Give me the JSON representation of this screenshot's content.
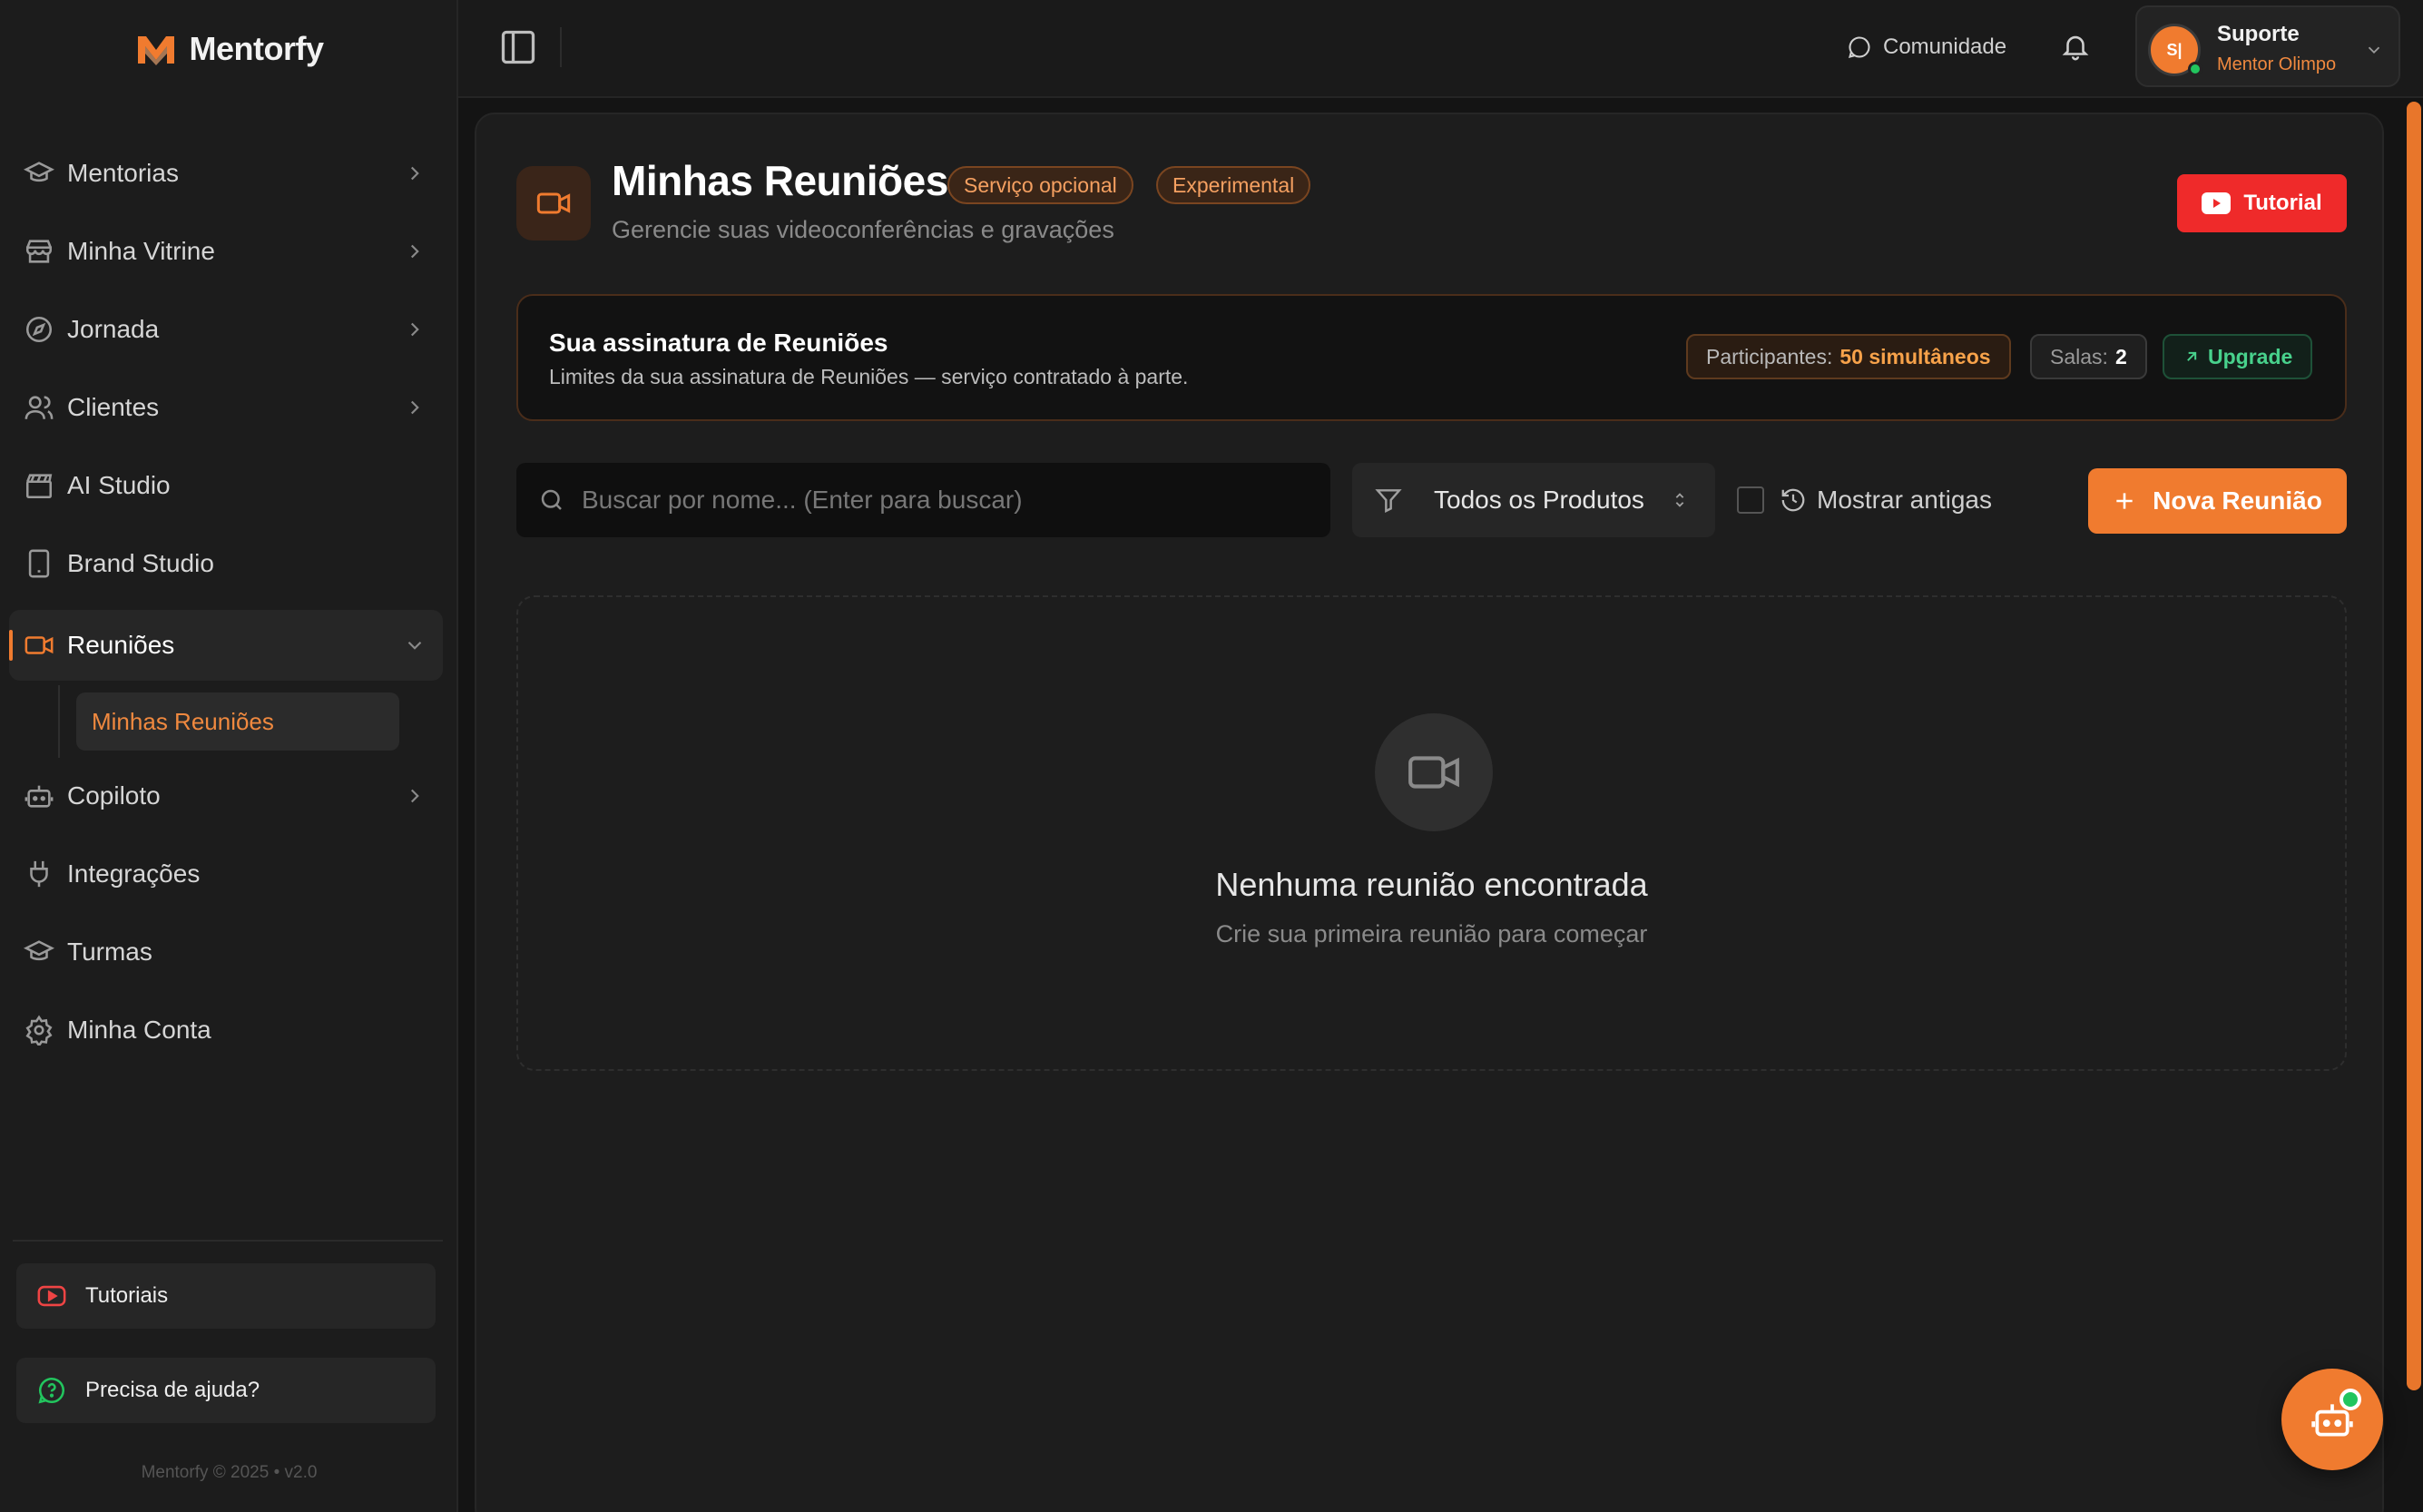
{
  "app": {
    "name": "Mentorfy",
    "accent": "#f07b2f"
  },
  "sidebar": {
    "items": [
      {
        "label": "Mentorias",
        "icon": "graduation-cap-icon",
        "has_chevron": true
      },
      {
        "label": "Minha Vitrine",
        "icon": "store-icon",
        "has_chevron": true
      },
      {
        "label": "Jornada",
        "icon": "compass-icon",
        "has_chevron": true
      },
      {
        "label": "Clientes",
        "icon": "users-icon",
        "has_chevron": true
      },
      {
        "label": "AI Studio",
        "icon": "clapperboard-icon",
        "has_chevron": false
      },
      {
        "label": "Brand Studio",
        "icon": "tablet-icon",
        "has_chevron": false
      },
      {
        "label": "Reuniões",
        "icon": "video-icon",
        "has_chevron": true,
        "active": true,
        "expanded": true
      },
      {
        "label": "Copiloto",
        "icon": "bot-icon",
        "has_chevron": true
      },
      {
        "label": "Integrações",
        "icon": "plug-icon",
        "has_chevron": false
      },
      {
        "label": "Turmas",
        "icon": "graduation-cap-icon",
        "has_chevron": false
      },
      {
        "label": "Minha Conta",
        "icon": "gear-icon",
        "has_chevron": false
      }
    ],
    "sub_items": [
      {
        "label": "Minhas Reuniões",
        "active": true
      }
    ],
    "tutorials_label": "Tutoriais",
    "help_label": "Precisa de ajuda?",
    "copyright": "Mentorfy © 2025 • v2.0"
  },
  "topbar": {
    "community_label": "Comunidade",
    "user": {
      "initials": "S|",
      "name": "Suporte",
      "role": "Mentor Olimpo",
      "online": true
    }
  },
  "header": {
    "title": "Minhas Reuniões",
    "badges": [
      "Serviço opcional",
      "Experimental"
    ],
    "subtitle": "Gerencie suas videoconferências e gravações",
    "tutorial_label": "Tutorial"
  },
  "subscription": {
    "title": "Sua assinatura de Reuniões",
    "description": "Limites da sua assinatura de Reuniões — serviço contratado à parte.",
    "participants_label": "Participantes:",
    "participants_value": "50 simultâneos",
    "rooms_label": "Salas:",
    "rooms_value": "2",
    "upgrade_label": "Upgrade"
  },
  "toolbar": {
    "search_placeholder": "Buscar por nome... (Enter para buscar)",
    "filter_value": "Todos os Produtos",
    "show_old_label": "Mostrar antigas",
    "show_old_checked": false,
    "new_meeting_label": "Nova Reunião"
  },
  "empty_state": {
    "title": "Nenhuma reunião encontrada",
    "subtitle": "Crie sua primeira reunião para começar"
  }
}
